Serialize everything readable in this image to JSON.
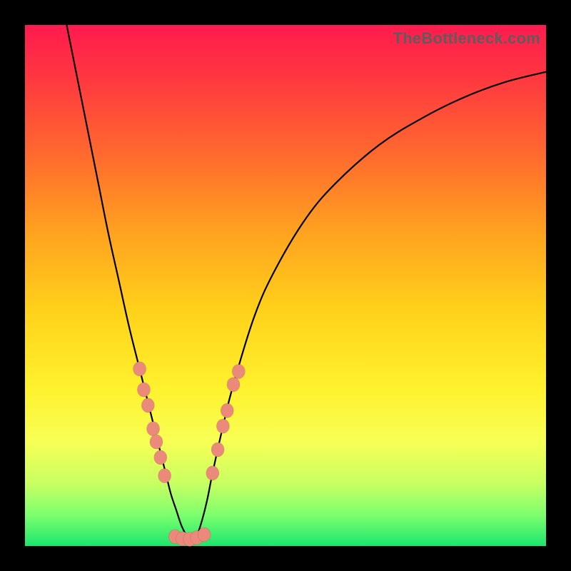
{
  "watermark": "TheBottleneck.com",
  "colors": {
    "background": "#000000",
    "dot_fill": "#eb8a7a",
    "gradient_top": "#ff1a4f",
    "gradient_bottom": "#1be66e",
    "curve_stroke": "#000000"
  },
  "chart_data": {
    "type": "line",
    "title": "",
    "xlabel": "",
    "ylabel": "",
    "xlim": [
      0,
      100
    ],
    "ylim": [
      0,
      100
    ],
    "axes_visible": false,
    "legend": null,
    "series": [
      {
        "name": "left-curve",
        "type": "line",
        "x": [
          8,
          10,
          12,
          14,
          16,
          18,
          20,
          22,
          24,
          26,
          27,
          28,
          29,
          30,
          31,
          32
        ],
        "y": [
          100,
          90,
          80,
          70,
          60,
          51,
          42,
          34,
          26,
          18,
          14,
          10,
          7,
          4,
          2,
          0.5
        ]
      },
      {
        "name": "right-curve",
        "type": "line",
        "x": [
          32,
          33,
          34,
          35,
          36,
          38,
          40,
          44,
          48,
          54,
          60,
          68,
          76,
          84,
          92,
          100
        ],
        "y": [
          0.5,
          2,
          5,
          9,
          14,
          23,
          31,
          44,
          53,
          63,
          70,
          77,
          82,
          86,
          89,
          91
        ]
      },
      {
        "name": "left-dots",
        "type": "scatter",
        "x": [
          22.0,
          22.8,
          23.6,
          24.6,
          25.2,
          26.0,
          26.8
        ],
        "y": [
          34.0,
          30.0,
          27.0,
          22.5,
          20.0,
          17.0,
          13.5
        ]
      },
      {
        "name": "right-dots",
        "type": "scatter",
        "x": [
          36.0,
          37.0,
          38.0,
          38.8,
          40.0,
          41.0
        ],
        "y": [
          14.0,
          18.5,
          23.0,
          26.0,
          31.0,
          33.5
        ]
      },
      {
        "name": "bottom-dots",
        "type": "scatter",
        "x": [
          28.8,
          30.2,
          31.6,
          33.0,
          34.4
        ],
        "y": [
          1.8,
          1.4,
          1.3,
          1.6,
          2.2
        ]
      }
    ],
    "annotations": []
  }
}
